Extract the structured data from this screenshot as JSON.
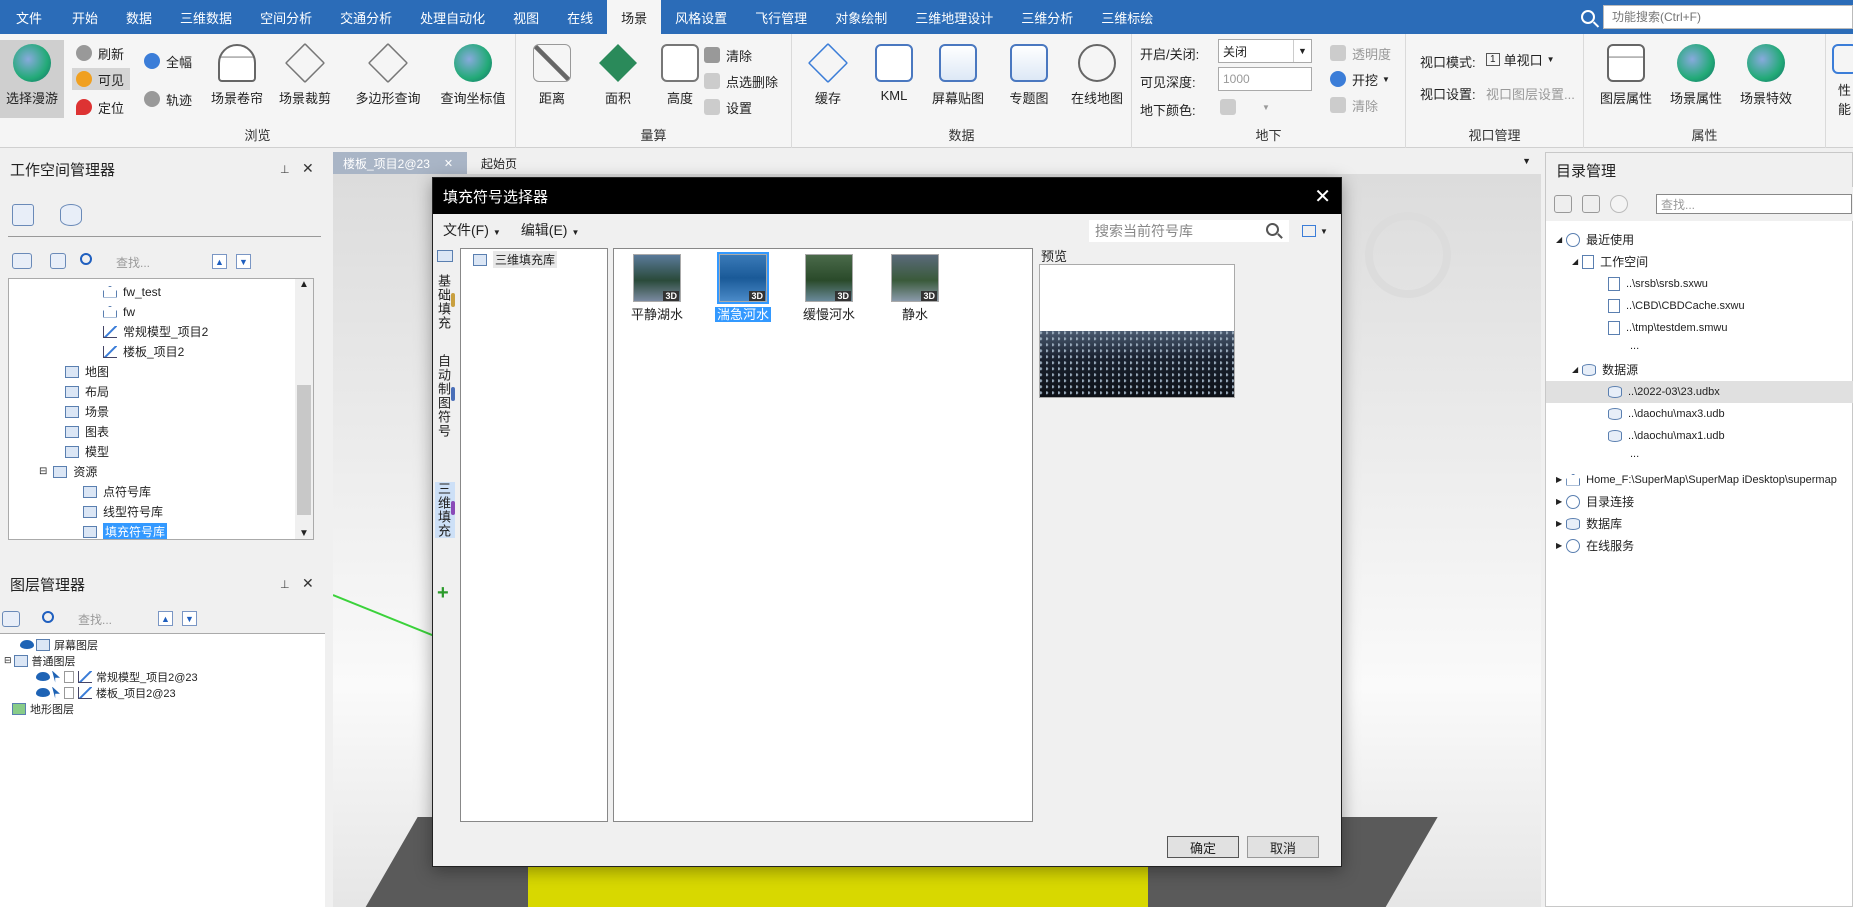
{
  "menubar": {
    "tabs": [
      "文件",
      "开始",
      "数据",
      "三维数据",
      "空间分析",
      "交通分析",
      "处理自动化",
      "视图",
      "在线",
      "场景",
      "风格设置",
      "飞行管理",
      "对象绘制",
      "三维地理设计",
      "三维分析",
      "三维标绘"
    ],
    "active_tab": "场景",
    "search_placeholder": "功能搜索(Ctrl+F)"
  },
  "ribbon": {
    "browse": {
      "label": "浏览",
      "select_roam": "选择漫游",
      "refresh": "刷新",
      "visible": "可见",
      "locate": "定位",
      "full_extent": "全幅",
      "track": "轨迹",
      "scene_curtain": "场景卷帘",
      "scene_clip": "场景裁剪",
      "polygon_query": "多边形查询",
      "query_coords": "查询坐标值"
    },
    "measure": {
      "label": "量算",
      "distance": "距离",
      "area": "面积",
      "height": "高度",
      "clear": "清除",
      "point_delete": "点选删除",
      "settings": "设置"
    },
    "data": {
      "label": "数据",
      "cache": "缓存",
      "kml": "KML",
      "screen_paste": "屏幕贴图",
      "thematic_map": "专题图",
      "online_map": "在线地图"
    },
    "underground": {
      "label": "地下",
      "on_off_label": "开启/关闭:",
      "on_off_value": "关闭",
      "visible_depth_label": "可见深度:",
      "visible_depth_value": "1000",
      "ground_color_label": "地下颜色:",
      "transparency": "透明度",
      "excavate": "开挖",
      "clear": "清除"
    },
    "viewport": {
      "label": "视口管理",
      "mode_label": "视口模式:",
      "mode_value": "单视口",
      "mode_number": "1",
      "settings_label": "视口设置:",
      "settings_value": "视口图层设置..."
    },
    "properties": {
      "label": "属性",
      "layer_props": "图层属性",
      "scene_props": "场景属性",
      "scene_effects": "场景特效",
      "performance": "性能"
    }
  },
  "workspace_panel": {
    "title": "工作空间管理器",
    "search_placeholder": "查找...",
    "items": [
      {
        "label": "fw_test"
      },
      {
        "label": "fw"
      },
      {
        "label": "常规模型_项目2"
      },
      {
        "label": "楼板_项目2"
      },
      {
        "label": "地图"
      },
      {
        "label": "布局"
      },
      {
        "label": "场景"
      },
      {
        "label": "图表"
      },
      {
        "label": "模型"
      },
      {
        "label": "资源"
      },
      {
        "label": "点符号库"
      },
      {
        "label": "线型符号库"
      },
      {
        "label": "填充符号库"
      }
    ]
  },
  "layer_panel": {
    "title": "图层管理器",
    "search_placeholder": "查找...",
    "items": [
      {
        "label": "屏幕图层"
      },
      {
        "label": "普通图层"
      },
      {
        "label": "常规模型_项目2@23"
      },
      {
        "label": "楼板_项目2@23"
      },
      {
        "label": "地形图层"
      }
    ]
  },
  "doc_tabs": {
    "tab1": "楼板_项目2@23",
    "tab2": "起始页"
  },
  "dialog": {
    "title": "填充符号选择器",
    "menu_file": "文件(F)",
    "menu_edit": "编辑(E)",
    "search_placeholder": "搜索当前符号库",
    "side_tabs": [
      "基础填充",
      "自动制图符号",
      "三维填充"
    ],
    "tree_root": "三维填充库",
    "symbols": [
      {
        "label": "平静湖水",
        "tag": "3D"
      },
      {
        "label": "湍急河水",
        "tag": "3D"
      },
      {
        "label": "缓慢河水",
        "tag": "3D"
      },
      {
        "label": "静水",
        "tag": "3D"
      }
    ],
    "selected_symbol": "湍急河水",
    "preview_label": "预览",
    "ok": "确定",
    "cancel": "取消"
  },
  "catalog_panel": {
    "title": "目录管理",
    "search_placeholder": "查找...",
    "recent": "最近使用",
    "workspace_group": "工作空间",
    "workspaces": [
      "..\\srsb\\srsb.sxwu",
      "..\\CBD\\CBDCache.sxwu",
      "..\\tmp\\testdem.smwu",
      "..."
    ],
    "datasource_group": "数据源",
    "datasources": [
      "..\\2022-03\\23.udbx",
      "..\\daochu\\max3.udb",
      "..\\daochu\\max1.udb",
      "..."
    ],
    "home": "Home_F:\\SuperMap\\SuperMap iDesktop\\supermap",
    "dir_connect": "目录连接",
    "database": "数据库",
    "online_service": "在线服务"
  }
}
